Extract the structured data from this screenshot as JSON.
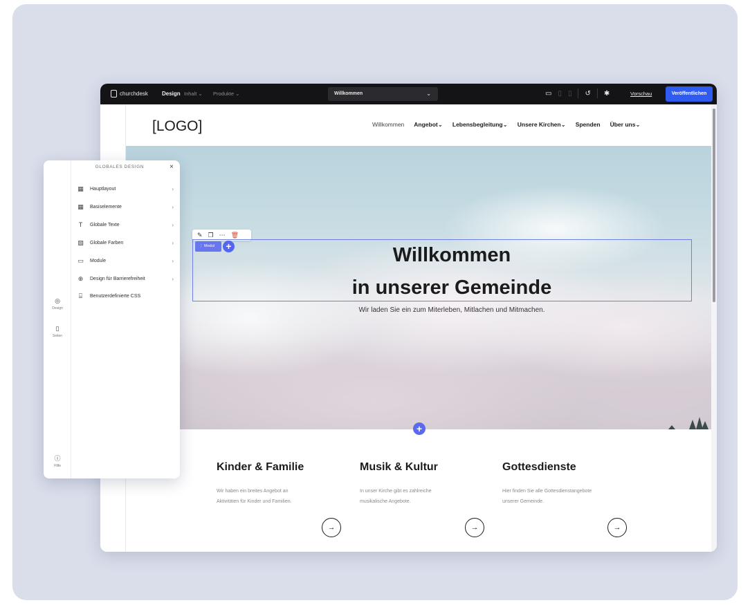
{
  "topbar": {
    "brand": "churchdesk",
    "tabs": [
      {
        "label": "Design"
      },
      {
        "label": "Inhalt ⌄"
      },
      {
        "label": "Produkte ⌄"
      }
    ],
    "page_select": "Willkommen",
    "preview": "Vorschau",
    "publish": "Veröffentlichen"
  },
  "site": {
    "logo": "[LOGO]",
    "menu": [
      "Willkommen",
      "Angebot⌄",
      "Lebensbegleitung⌄",
      "Unsere Kirchen⌄",
      "Spenden",
      "Über uns⌄"
    ],
    "hero": {
      "title_line1": "Willkommen",
      "title_line2": "in unserer Gemeinde",
      "subtitle": "Wir laden Sie ein zum Miterleben, Mitlachen und Mitmachen.",
      "selection_tag": "⋮ Modul"
    },
    "cards": [
      {
        "title": "Kinder & Familie",
        "text_line1": "Wir haben ein breites Angebot an",
        "text_line2": "Aktivitäten für Kinder und Familien."
      },
      {
        "title": "Musik & Kultur",
        "text_line1": "In unser Kirche gibt es zahlreiche",
        "text_line2": "musikalische Angebote."
      },
      {
        "title": "Gottesdienste",
        "text_line1": "Hier finden Sie alle Gottesdienstangebote",
        "text_line2": "unserer Gemeinde."
      }
    ]
  },
  "panel": {
    "title": "GLOBALES DESIGN",
    "items": [
      {
        "label": "Hauptlayout",
        "icon": "layout-icon"
      },
      {
        "label": "Basiselemente",
        "icon": "grid-icon"
      },
      {
        "label": "Globale Texte",
        "icon": "text-icon"
      },
      {
        "label": "Globale Farben",
        "icon": "palette-icon"
      },
      {
        "label": "Module",
        "icon": "module-icon"
      },
      {
        "label": "Design für Barrierefreiheit",
        "icon": "accessibility-icon"
      },
      {
        "label": "Benutzerdefinierte CSS",
        "icon": "code-icon"
      }
    ],
    "rail": [
      {
        "label": "Design"
      },
      {
        "label": "Seiten"
      },
      {
        "label": "Hilfe"
      }
    ]
  },
  "colors": {
    "accent": "#2f5bf0",
    "selection": "#6877ef",
    "topbar": "#141416",
    "frame": "#dadeeb"
  }
}
